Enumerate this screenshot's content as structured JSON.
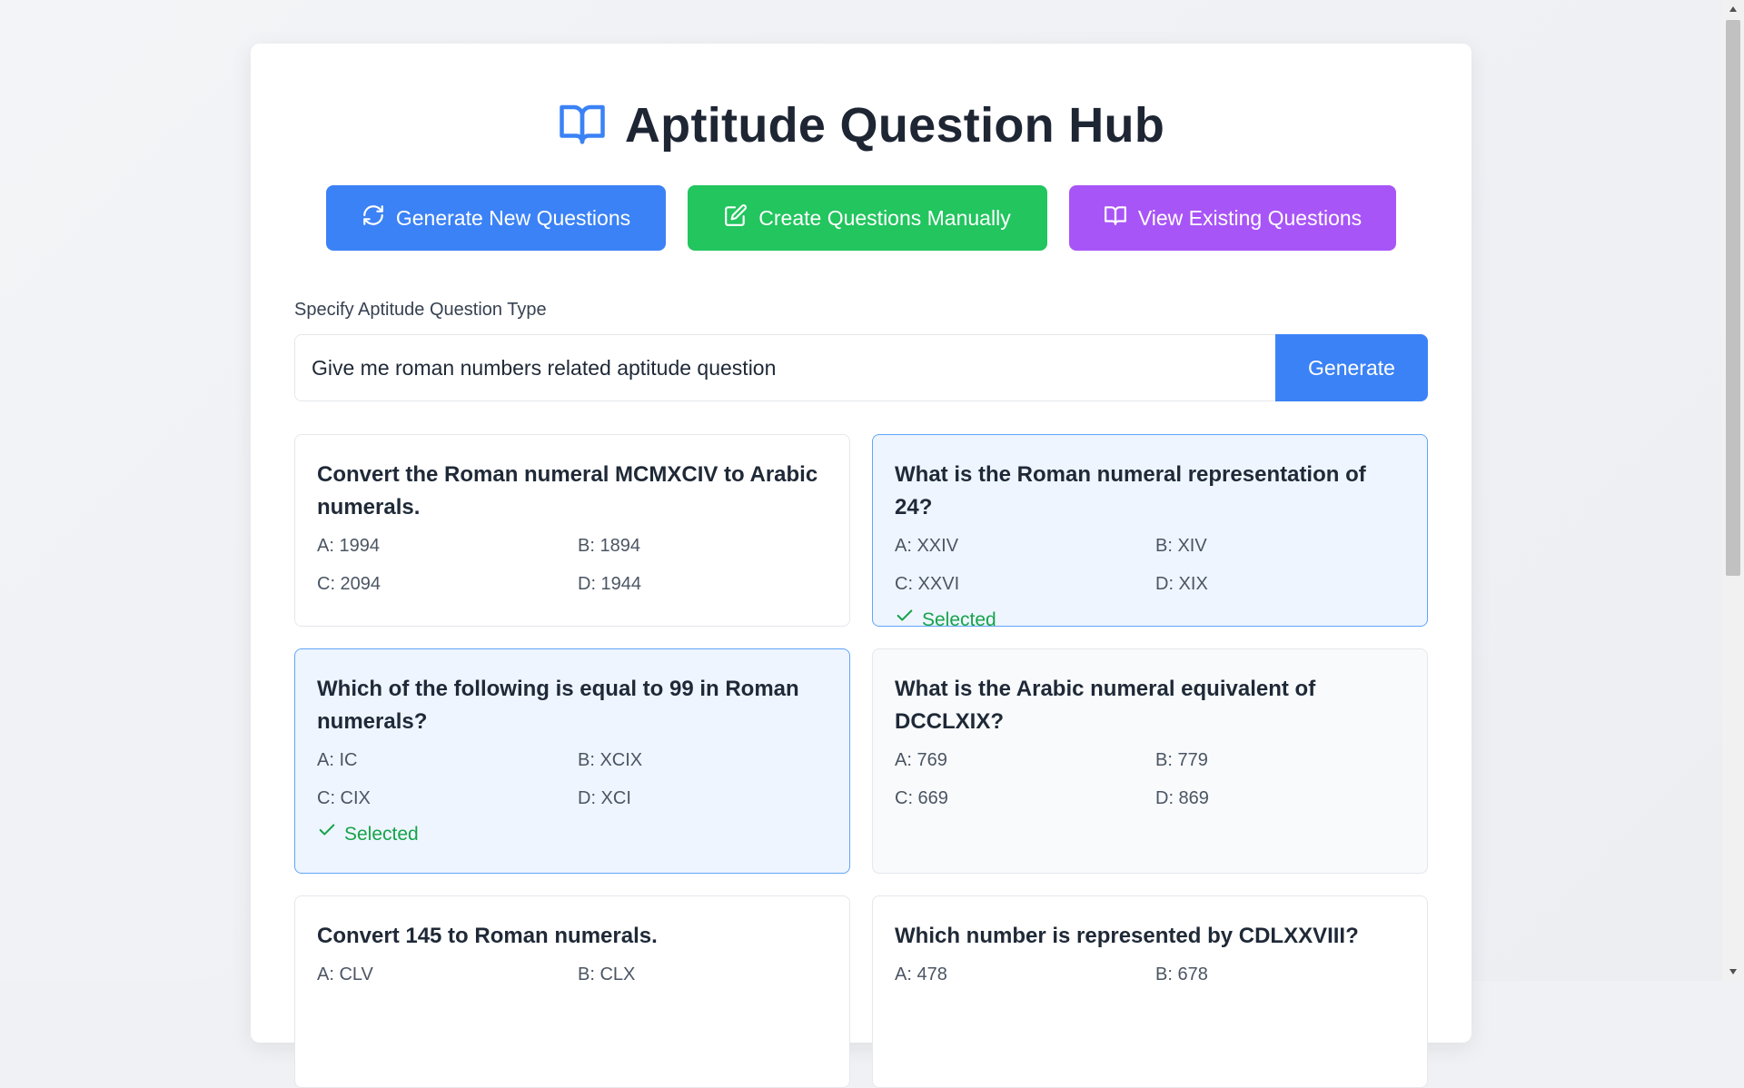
{
  "header": {
    "title": "Aptitude Question Hub",
    "icon": "book-open-icon",
    "icon_color": "#3b82f6"
  },
  "actions": {
    "generate_new": "Generate New Questions",
    "create_manual": "Create Questions Manually",
    "view_existing": "View Existing Questions"
  },
  "colors": {
    "blue": "#3b82f6",
    "green": "#22c55e",
    "purple": "#a855f7",
    "selected_bg": "#eef5ff",
    "selected_text": "#16a34a"
  },
  "type_form": {
    "label": "Specify Aptitude Question Type",
    "value": "Give me roman numbers related aptitude question",
    "placeholder": "",
    "generate_label": "Generate"
  },
  "questions": [
    {
      "text": "Convert the Roman numeral MCMXCIV to Arabic numerals.",
      "a": "A: 1994",
      "b": "B: 1894",
      "c": "C: 2094",
      "d": "D: 1944",
      "selected": false,
      "selected_label": ""
    },
    {
      "text": "What is the Roman numeral representation of 24?",
      "a": "A: XXIV",
      "b": "B: XIV",
      "c": "C: XXVI",
      "d": "D: XIX",
      "selected": true,
      "selected_label": "Selected"
    },
    {
      "text": "Which of the following is equal to 99 in Roman numerals?",
      "a": "A: IC",
      "b": "B: XCIX",
      "c": "C: CIX",
      "d": "D: XCI",
      "selected": true,
      "selected_label": "Selected"
    },
    {
      "text": "What is the Arabic numeral equivalent of DCCLXIX?",
      "a": "A: 769",
      "b": "B: 779",
      "c": "C: 669",
      "d": "D: 869",
      "selected": false,
      "selected_label": ""
    },
    {
      "text": "Convert 145 to Roman numerals.",
      "a": "A: CLV",
      "b": "B: CLX",
      "c": "",
      "d": "",
      "selected": false,
      "selected_label": ""
    },
    {
      "text": "Which number is represented by CDLXXVIII?",
      "a": "A: 478",
      "b": "B: 678",
      "c": "",
      "d": "",
      "selected": false,
      "selected_label": ""
    }
  ]
}
